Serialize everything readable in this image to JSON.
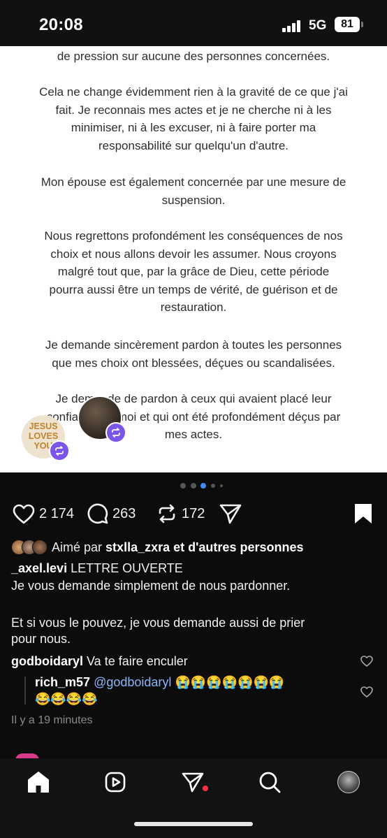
{
  "status_bar": {
    "time": "20:08",
    "network": "5G",
    "battery": "81"
  },
  "letter": {
    "paragraphs": [
      [
        "de pression sur aucune des personnes concernées."
      ],
      [
        "Cela ne change évidemment rien à la gravité de ce que j'ai",
        "fait. Je reconnais mes actes et je ne cherche ni à les",
        "minimiser, ni à les excuser, ni à faire porter ma",
        "responsabilité sur quelqu'un d'autre."
      ],
      [
        "Mon épouse est également concernée par une mesure de",
        "suspension."
      ],
      [
        "Nous regrettons profondément les conséquences de nos",
        "choix et nous allons devoir les assumer. Nous croyons",
        "malgré tout que, par la grâce de Dieu, cette période",
        "pourra aussi être un temps de vérité, de guérison et de",
        "restauration."
      ],
      [
        "Je demande sincèrement pardon à toutes les personnes",
        "que mes choix ont blessées, déçues ou scandalisées."
      ],
      [
        "Je demande de pardon à ceux qui avaient placé leur",
        "confiance en moi et qui ont été profondément déçus par",
        "mes actes."
      ]
    ]
  },
  "reposters": {
    "avatar1_text": "JESUS LOVES YOU"
  },
  "actions": {
    "likes": "2 174",
    "comments": "263",
    "reposts": "172"
  },
  "liked_by": {
    "prefix": "Aimé par",
    "user": "stxlla_zxra",
    "suffix": "et d'autres personnes"
  },
  "caption": {
    "username": "_axel.levi",
    "title": "LETTRE OUVERTE",
    "line1": "Je vous demande simplement de nous pardonner.",
    "line2": "Et si vous le pouvez, je vous demande aussi de prier",
    "line3": "pour nous."
  },
  "comments": [
    {
      "username": "godboidaryl",
      "text": "Va te faire enculer"
    },
    {
      "username": "rich_m57",
      "mention": "@godboidaryl",
      "emoji1": "😭😭😭😭😭😭😭",
      "emoji2": "😂😂😂😂"
    }
  ],
  "time_ago": "Il y a 19 minutes",
  "colors": {
    "accent_purple": "#7b55e8",
    "notification_red": "#ff3040",
    "background": "#0c0c0d"
  },
  "icons": [
    "heart-icon",
    "comment-icon",
    "repost-icon",
    "send-icon",
    "bookmark-icon",
    "home-icon",
    "reels-icon",
    "direct-icon",
    "search-icon",
    "profile-avatar"
  ]
}
